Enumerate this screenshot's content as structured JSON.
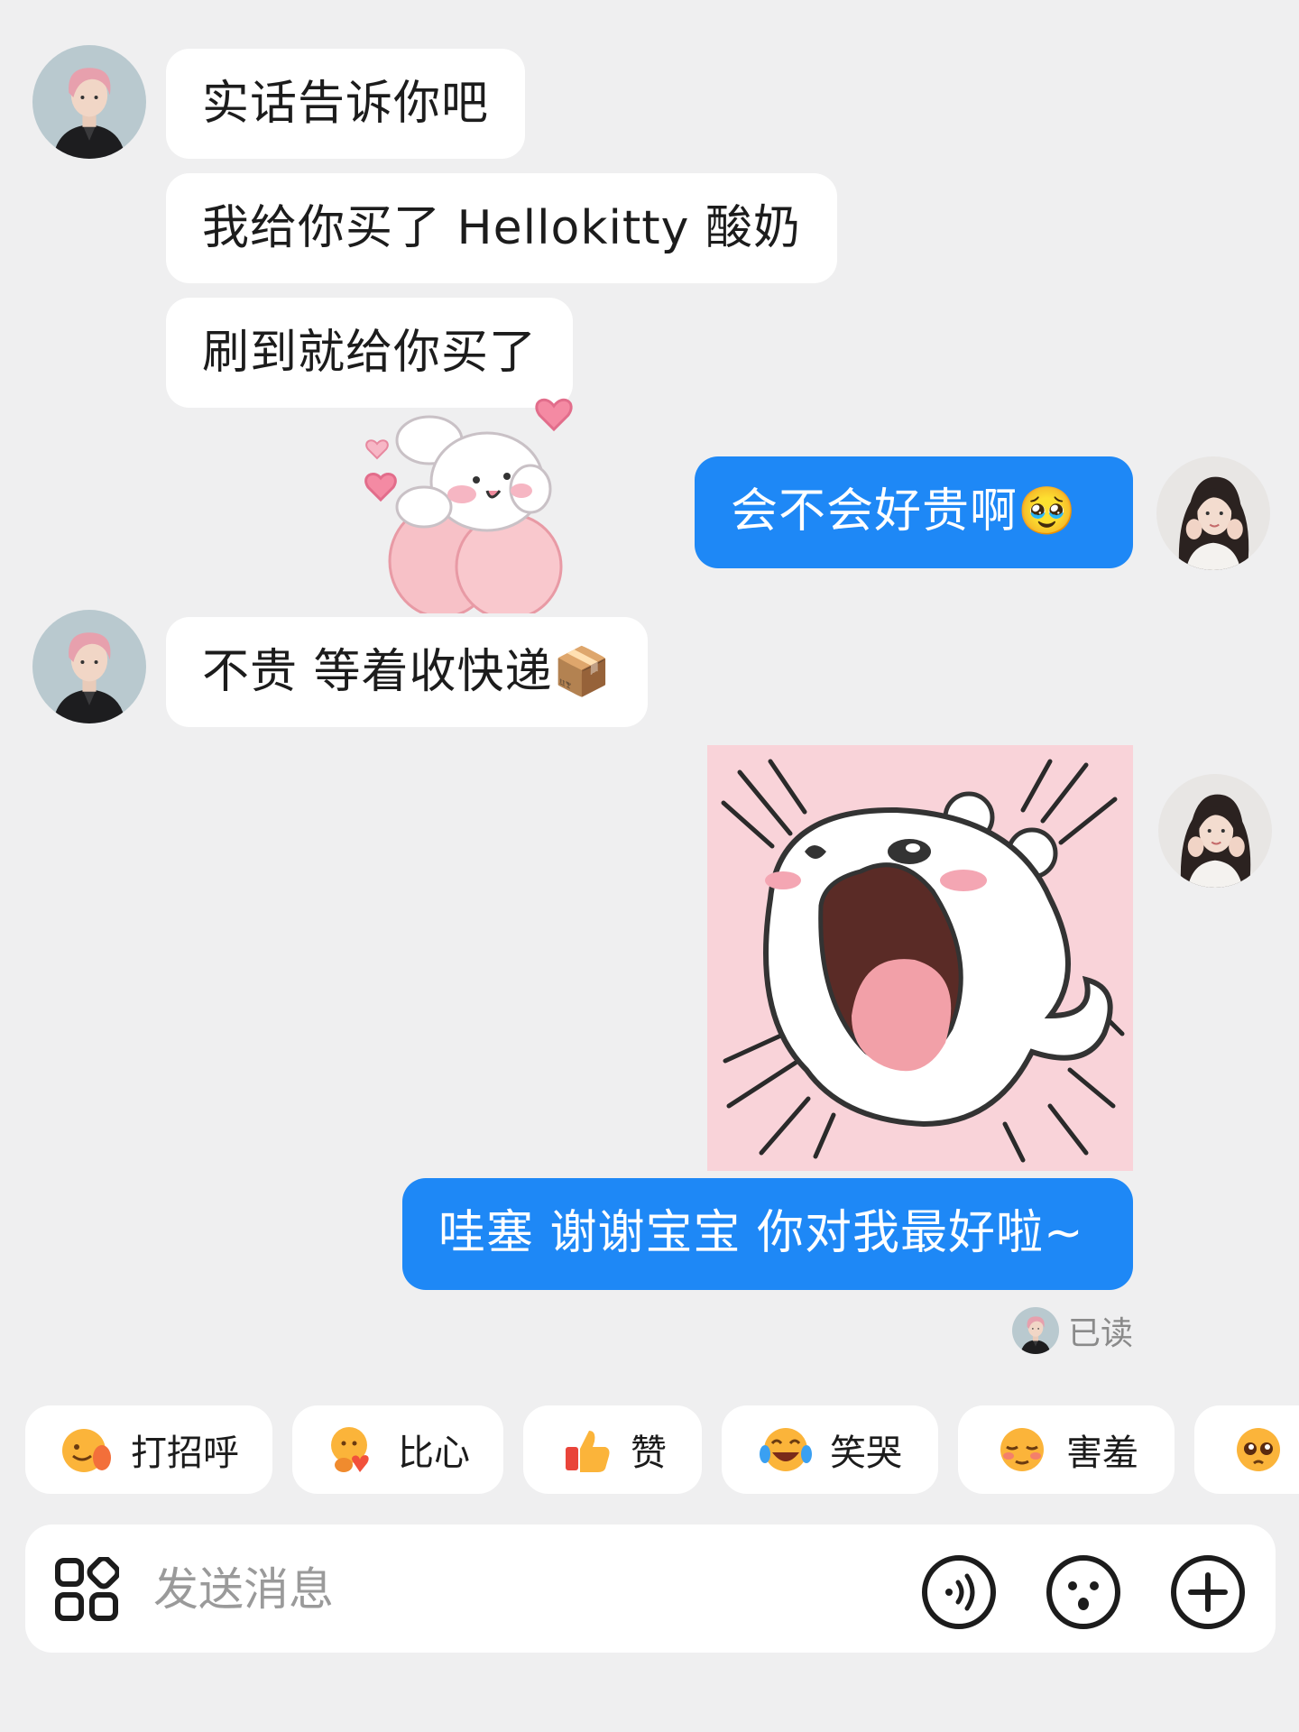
{
  "chat": {
    "messages": [
      {
        "from": "boyfriend",
        "text": "实话告诉你吧"
      },
      {
        "from": "boyfriend",
        "text": "我给你买了 Hellokitty 酸奶"
      },
      {
        "from": "boyfriend",
        "text": "刷到就给你买了"
      },
      {
        "from": "me",
        "text": "会不会好贵啊🥹"
      },
      {
        "from": "boyfriend",
        "text": "不贵 等着收快递📦"
      },
      {
        "from": "me",
        "text": "哇塞 谢谢宝宝 你对我最好啦~"
      }
    ],
    "read_status": "已读"
  },
  "quick_replies": [
    {
      "icon": "wave-hand-emoji-icon",
      "label": "打招呼"
    },
    {
      "icon": "finger-heart-emoji-icon",
      "label": "比心"
    },
    {
      "icon": "thumbs-up-emoji-icon",
      "label": "赞"
    },
    {
      "icon": "laugh-cry-emoji-icon",
      "label": "笑哭"
    },
    {
      "icon": "shy-emoji-icon",
      "label": "害羞"
    },
    {
      "icon": "pleading-emoji-icon",
      "label": ""
    }
  ],
  "composer": {
    "placeholder": "发送消息",
    "icons": [
      "apps-grid-icon",
      "voice-icon",
      "emoji-icon",
      "plus-icon"
    ]
  },
  "colors": {
    "background": "#efeff0",
    "incoming_bubble": "#ffffff",
    "outgoing_bubble": "#1e88f6",
    "sticker_bg": "#f9d3d9"
  }
}
